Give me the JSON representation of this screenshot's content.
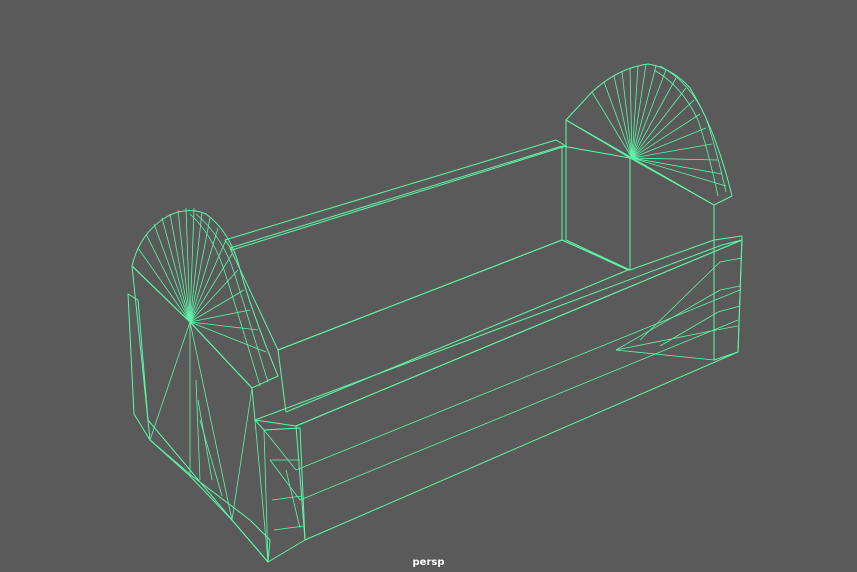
{
  "viewport": {
    "camera_label": "persp",
    "background_color": "#5a5a5a",
    "wireframe_color": "#5ef5a8"
  }
}
